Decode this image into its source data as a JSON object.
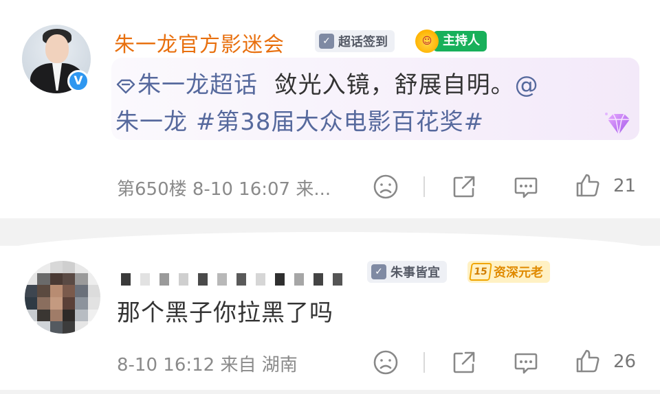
{
  "comments": [
    {
      "username": "朱一龙官方影迷会",
      "badges": {
        "chaohua": "超话签到",
        "role": "主持人"
      },
      "post": {
        "topic_link": "朱一龙超话",
        "text": "敛光入镜，舒展自明。",
        "mention_at": "@",
        "mention": "朱一龙",
        "hashtag": "#第38届大众电影百花奖#"
      },
      "meta": "第650楼 8-10 16:07 来...",
      "likes": "21"
    },
    {
      "badges": {
        "topic": "朱事皆宜",
        "level": "15",
        "rank": "资深元老"
      },
      "text": "那个黑子你拉黑了吗",
      "meta": "8-10 16:12 来自 湖南",
      "likes": "26"
    }
  ],
  "icons": {
    "verified": "v-verified-icon",
    "dislike": "sad-face-icon",
    "share": "share-icon",
    "reply": "comment-icon",
    "like": "thumbs-up-icon"
  },
  "colors": {
    "username": "#e8700f",
    "link": "#56699d",
    "host_badge": "#18b05a",
    "verified": "#2f97f0",
    "senior_badge": "#e08a00"
  }
}
